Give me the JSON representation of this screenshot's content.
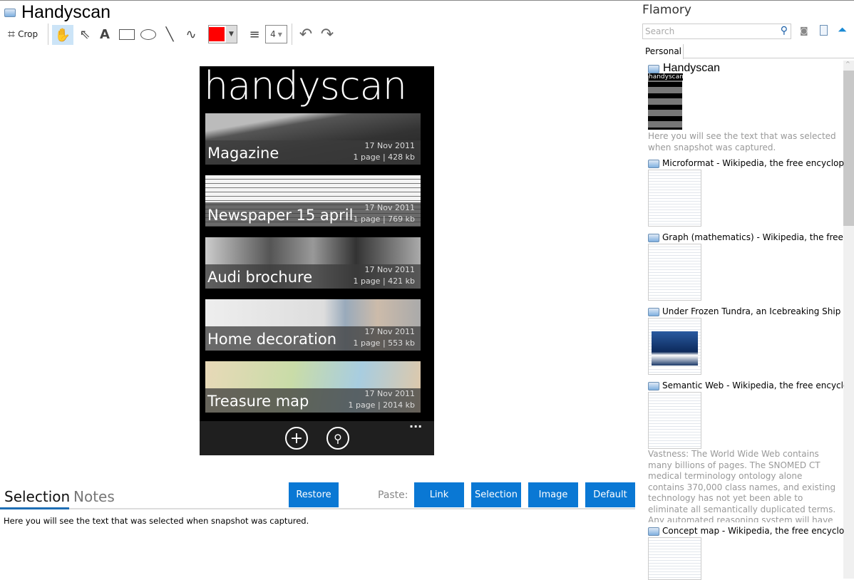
{
  "window": {
    "title": "Handyscan"
  },
  "toolbar": {
    "crop_label": "Crop",
    "line_width": "4",
    "color": "#ff0000"
  },
  "phone": {
    "header": "handyscan",
    "items": [
      {
        "name": "Magazine",
        "date": "17 Nov 2011",
        "info": "1 page | 428 kb"
      },
      {
        "name": "Newspaper 15 april",
        "date": "17 Nov 2011",
        "info": "1 page | 769 kb"
      },
      {
        "name": "Audi brochure",
        "date": "17 Nov 2011",
        "info": "1 page | 421 kb"
      },
      {
        "name": "Home decoration",
        "date": "17 Nov 2011",
        "info": "1 page | 553 kb"
      },
      {
        "name": "Treasure map",
        "date": "17 Nov 2011",
        "info": "1 page | 2014 kb"
      }
    ],
    "more": "..."
  },
  "bottom": {
    "tabs": [
      "Selection",
      "Notes"
    ],
    "restore": "Restore",
    "paste_label": "Paste:",
    "paste_buttons": [
      "Link",
      "Selection",
      "Image",
      "Default"
    ],
    "selection_text": "Here you will see the text that was selected when snapshot was captured."
  },
  "sidebar": {
    "title": "Flamory",
    "search_placeholder": "Search",
    "tab": "Personal",
    "current": {
      "title": "Handyscan",
      "thumb_text": "handyscan",
      "text": "Here you will see the text that was selected when snapshot was captured."
    },
    "entries": [
      {
        "title": "Microformat - Wikipedia, the free encyclopedia"
      },
      {
        "title": "Graph (mathematics) - Wikipedia, the free encyclopedia"
      },
      {
        "title": "Under Frozen Tundra, an Icebreaking Ship Uncovers"
      },
      {
        "title": "Semantic Web - Wikipedia, the free encyclopedia",
        "text": "Vastness: The World Wide Web contains many billions of pages. The SNOMED CT medical terminology ontology alone contains 370,000 class names, and existing technology has not yet been able to eliminate all semantically duplicated terms. Any automated reasoning system will have to deal with truly huge inputs."
      },
      {
        "title": "Concept map - Wikipedia, the free encyclopedia"
      }
    ]
  },
  "colors": {
    "accent": "#0a78d4"
  }
}
